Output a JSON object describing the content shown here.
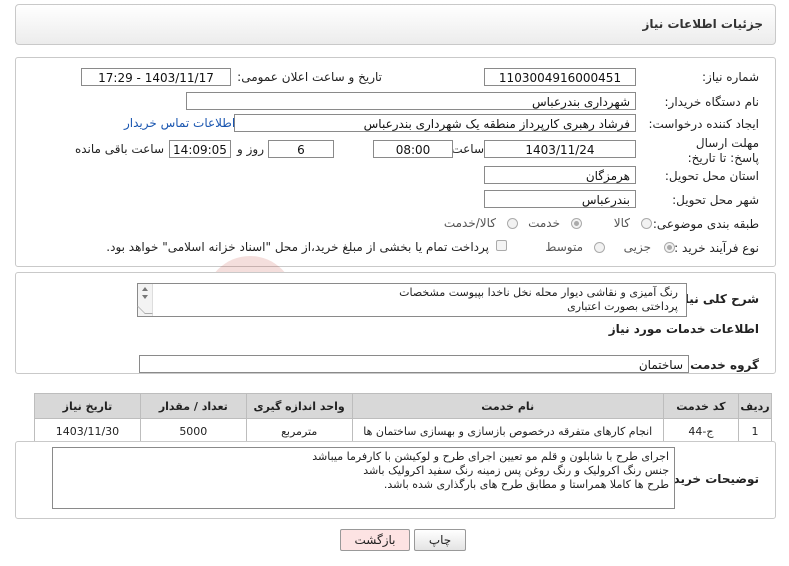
{
  "page_title": "جزئیات اطلاعات نیاز",
  "fields": {
    "need_number_label": "شماره نیاز:",
    "need_number": "1103004916000451",
    "announce_label": "تاریخ و ساعت اعلان عمومی:",
    "announce_value": "1403/11/17 - 17:29",
    "buyer_org_label": "نام دستگاه خریدار:",
    "buyer_org": "شهرداری بندرعباس",
    "creator_label": "ایجاد کننده درخواست:",
    "creator": "فرشاد رهبری کارپرداز منطقه یک شهرداری بندرعباس",
    "contact_link": "اطلاعات تماس خریدار",
    "deadline_label": "مهلت ارسال پاسخ: تا تاریخ:",
    "deadline_date": "1403/11/24",
    "hour_label": "ساعت",
    "deadline_hour": "08:00",
    "days": "6",
    "days_label": "روز و",
    "remaining": "14:09:05",
    "remaining_label": "ساعت باقی مانده",
    "province_label": "استان محل تحویل:",
    "province": "هرمزگان",
    "city_label": "شهر محل تحویل:",
    "city": "بندرعباس",
    "category_label": "طبقه بندی موضوعی:",
    "category_options": [
      "کالا",
      "خدمت",
      "کالا/خدمت"
    ],
    "category_selected": "خدمت",
    "process_label": "نوع فرآیند خرید :",
    "process_options": [
      "جزیی",
      "متوسط"
    ],
    "process_selected": "جزیی",
    "treasury_note": "پرداخت تمام یا بخشی از مبلغ خرید،از محل \"اسناد خزانه اسلامی\" خواهد بود."
  },
  "summary": {
    "label": "شرح کلی نیاز:",
    "line1": "رنگ آمیزی و نقاشی دیوار محله نخل ناخدا  بپیوست مشخصات",
    "line2": "پرداختی بصورت اعتباری"
  },
  "services": {
    "section_title": "اطلاعات خدمات مورد نیاز",
    "group_label": "گروه خدمت:",
    "group_value": "ساختمان",
    "columns": [
      "ردیف",
      "کد خدمت",
      "نام خدمت",
      "واحد اندازه گیری",
      "تعداد / مقدار",
      "تاریخ نیاز"
    ],
    "rows": [
      [
        "1",
        "ج-44",
        "انجام کارهای متفرقه درخصوص بازسازی و بهسازی ساختمان ها",
        "مترمربع",
        "5000",
        "1403/11/30"
      ]
    ]
  },
  "buyer_notes": {
    "label": "توضیحات خریدار:",
    "lines": [
      "اجرای طرح با شابلون و قلم مو تعیین اجرای طرح و لوکیشن با کارفرما میباشد",
      "جنس رنگ اکرولیک و رنگ روغن پس زمینه رنگ سفید اکرولیک باشد",
      "طرح ها کاملا همراستا و مطابق طرح های بارگذاری شده باشد."
    ]
  },
  "buttons": {
    "print": "چاپ",
    "back": "بازگشت"
  },
  "watermark": {
    "text": "AriaTender.net",
    "color": "#c0392b"
  },
  "colors": {
    "link": "#1a56b0",
    "back_button_bg": "#fde3e3"
  }
}
